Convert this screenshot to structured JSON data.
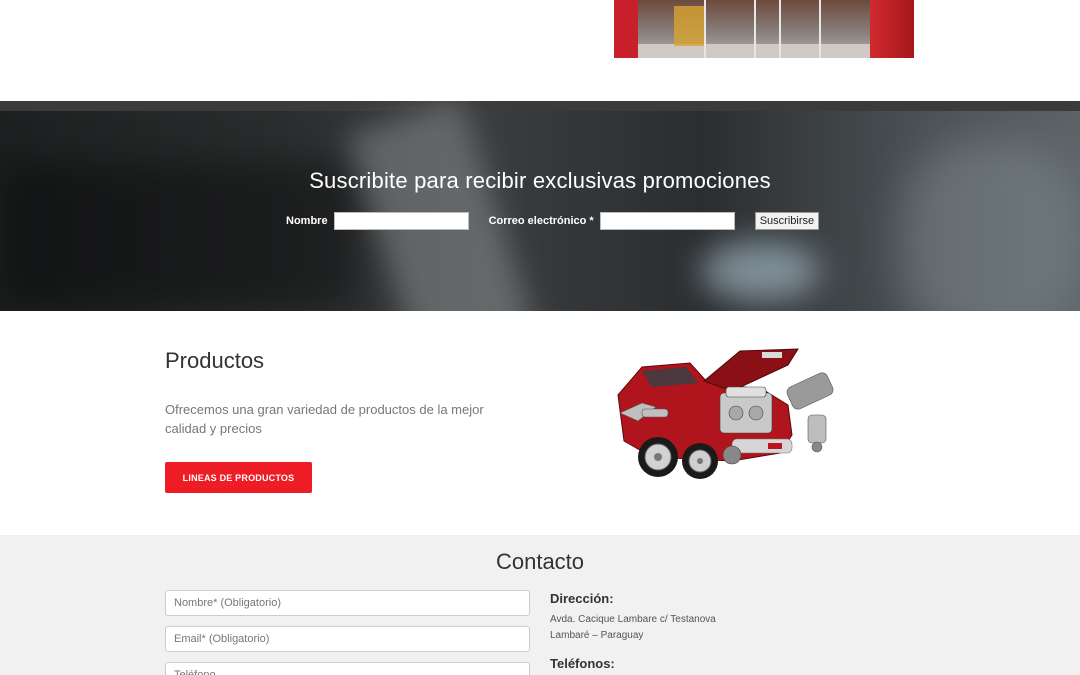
{
  "subscribe": {
    "title": "Suscribite para recibir exclusivas promociones",
    "name_label": "Nombre",
    "email_label": "Correo electrónico *",
    "name_value": "",
    "email_value": "",
    "submit_label": "Suscribirse"
  },
  "products": {
    "title": "Productos",
    "description": "Ofrecemos una gran variedad de productos de la mejor calidad y precios",
    "button_label": "LINEAS DE PRODUCTOS"
  },
  "contact": {
    "title": "Contacto",
    "name_placeholder": "Nombre* (Obligatorio)",
    "email_placeholder": "Email* (Obligatorio)",
    "phone_placeholder": "Teléfono",
    "address_label": "Dirección:",
    "address_line1": "Avda. Cacique Lambare c/ Testanova",
    "address_line2": "Lambaré – Paraguay",
    "phones_label": "Teléfonos:"
  },
  "colors": {
    "accent": "#ee1c25",
    "contact_bg": "#f1f1f2"
  }
}
